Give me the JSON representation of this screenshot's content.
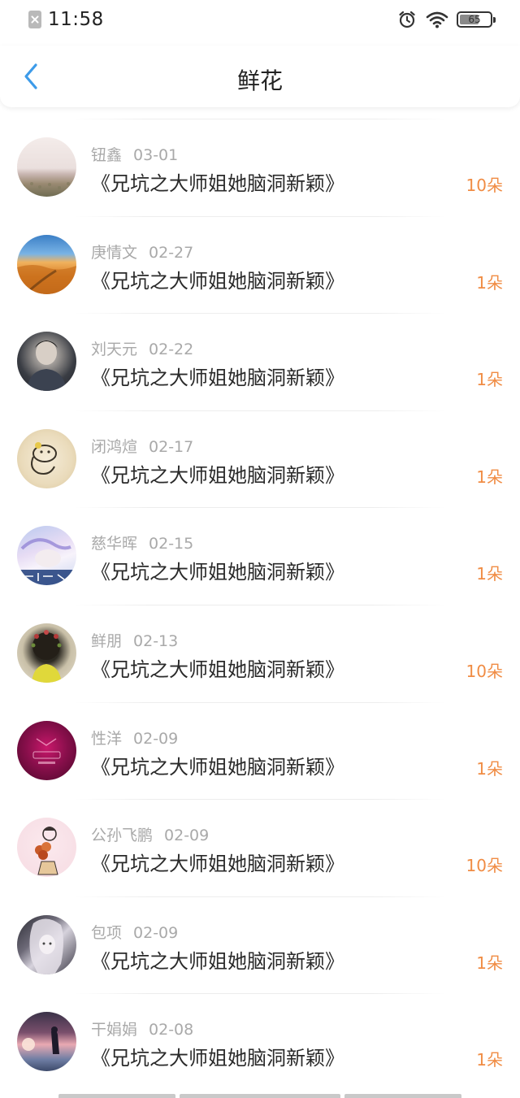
{
  "status_bar": {
    "time": "11:58",
    "battery": "65",
    "battery_fraction": 0.65,
    "icons": [
      "sim-off-icon",
      "alarm-icon",
      "wifi-icon",
      "battery-icon"
    ]
  },
  "header": {
    "title": "鲜花",
    "back_icon": "chevron-left-icon"
  },
  "colors": {
    "accent": "#3d9be9",
    "amount": "#f08c44",
    "meta": "#a9a9a9",
    "title": "#2a2a2a"
  },
  "list": {
    "items": [
      {
        "user": "钮鑫",
        "date": "03-01",
        "title": "《兄坑之大师姐她脑洞新颖》",
        "amount": "10朵"
      },
      {
        "user": "庚情文",
        "date": "02-27",
        "title": "《兄坑之大师姐她脑洞新颖》",
        "amount": "1朵"
      },
      {
        "user": "刘天元",
        "date": "02-22",
        "title": "《兄坑之大师姐她脑洞新颖》",
        "amount": "1朵"
      },
      {
        "user": "闭鸿煊",
        "date": "02-17",
        "title": "《兄坑之大师姐她脑洞新颖》",
        "amount": "1朵"
      },
      {
        "user": "慈华晖",
        "date": "02-15",
        "title": "《兄坑之大师姐她脑洞新颖》",
        "amount": "1朵"
      },
      {
        "user": "鲜朋",
        "date": "02-13",
        "title": "《兄坑之大师姐她脑洞新颖》",
        "amount": "10朵"
      },
      {
        "user": "性洋",
        "date": "02-09",
        "title": "《兄坑之大师姐她脑洞新颖》",
        "amount": "1朵"
      },
      {
        "user": "公孙飞鹏",
        "date": "02-09",
        "title": "《兄坑之大师姐她脑洞新颖》",
        "amount": "10朵"
      },
      {
        "user": "包项",
        "date": "02-09",
        "title": "《兄坑之大师姐她脑洞新颖》",
        "amount": "1朵"
      },
      {
        "user": "干娟娟",
        "date": "02-08",
        "title": "《兄坑之大师姐她脑洞新颖》",
        "amount": "1朵"
      }
    ]
  }
}
